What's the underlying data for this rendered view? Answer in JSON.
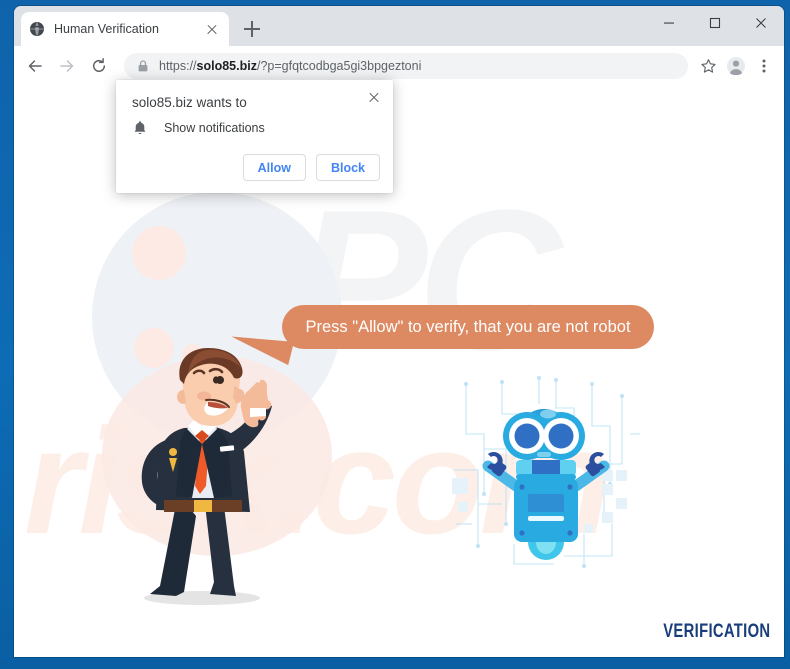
{
  "browser": {
    "tab": {
      "title": "Human Verification",
      "favicon": "globe-icon",
      "close_label": "close-tab"
    },
    "new_tab_label": "new-tab",
    "window_controls": {
      "minimize": "minimize",
      "maximize": "maximize",
      "close": "close"
    },
    "toolbar": {
      "back": "back",
      "forward": "forward",
      "reload": "reload",
      "url_scheme": "https://",
      "url_host": "solo85.biz",
      "url_path": "/?p=gfqtcodbga5gi3bpgeztoni",
      "url_full": "https://solo85.biz/?p=gfqtcodbga5gi3bpgeztoni",
      "lock_icon": "lock-icon",
      "bookmark_icon": "star-icon",
      "profile_icon": "avatar-icon",
      "menu_icon": "three-dot-menu-icon"
    }
  },
  "dialog": {
    "title": "solo85.biz wants to",
    "permission": "Show notifications",
    "permission_icon": "bell-icon",
    "allow_label": "Allow",
    "block_label": "Block",
    "close_label": "Close"
  },
  "page": {
    "speech_bubble": "Press \"Allow\" to verify, that you are not robot",
    "verification_label": "VERIFICATION",
    "watermark_top": "PC",
    "watermark_bottom": "risk.com",
    "characters": {
      "businessman": "pointing-businessman-illustration",
      "robot": "blue-robot-illustration"
    }
  },
  "colors": {
    "window_frame": "#0f63ab",
    "tab_strip": "#dee1e6",
    "omnibox": "#f1f3f4",
    "dialog_button_text": "#4285f4",
    "speech_bubble": "#dd8961",
    "verification_text": "#1a3d7c",
    "robot_primary": "#29abe2",
    "robot_dark": "#1f5fb5",
    "suit_dark": "#26303f",
    "tie_orange": "#f05a28"
  }
}
